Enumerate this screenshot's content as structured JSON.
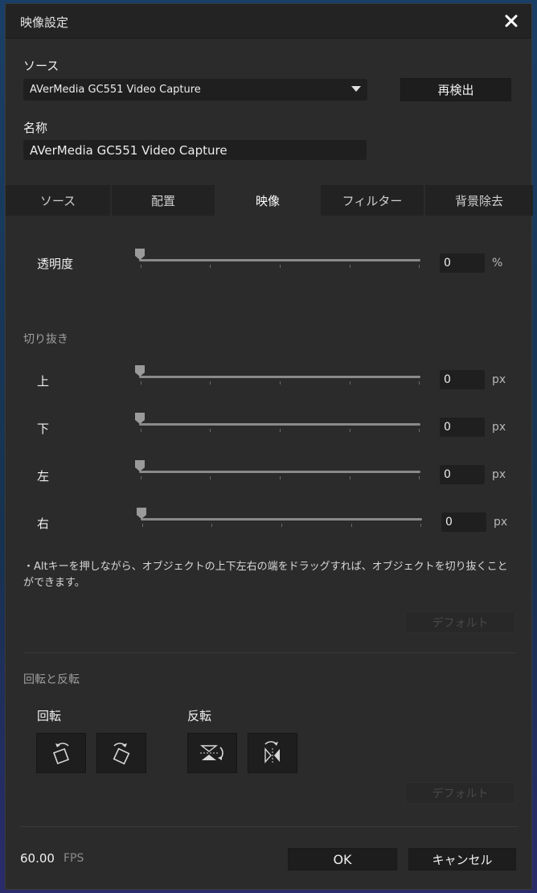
{
  "window": {
    "title": "映像設定"
  },
  "source": {
    "label": "ソース",
    "device_value": "AVerMedia GC551 Video Capture",
    "rescan_label": "再検出"
  },
  "name": {
    "label": "名称",
    "value": "AVerMedia GC551 Video Capture"
  },
  "tabs": [
    {
      "label": "ソース",
      "active": false
    },
    {
      "label": "配置",
      "active": false
    },
    {
      "label": "映像",
      "active": true
    },
    {
      "label": "フィルター",
      "active": false
    },
    {
      "label": "背景除去",
      "active": false
    }
  ],
  "opacity": {
    "label": "透明度",
    "value": "0",
    "unit": "%"
  },
  "crop": {
    "heading": "切り抜き",
    "rows": [
      {
        "label": "上",
        "value": "0",
        "unit": "px"
      },
      {
        "label": "下",
        "value": "0",
        "unit": "px"
      },
      {
        "label": "左",
        "value": "0",
        "unit": "px"
      },
      {
        "label": "右",
        "value": "0",
        "unit": "px"
      }
    ],
    "hint": "・Altキーを押しながら、オブジェクトの上下左右の端をドラッグすれば、オブジェクトを切り抜くことができます。",
    "default_label": "デフォルト"
  },
  "rotate_flip": {
    "heading": "回転と反転",
    "rotate_label": "回転",
    "flip_label": "反転",
    "default_label": "デフォルト"
  },
  "footer": {
    "fps_value": "60.00",
    "fps_unit": "FPS",
    "ok_label": "OK",
    "cancel_label": "キャンセル"
  }
}
